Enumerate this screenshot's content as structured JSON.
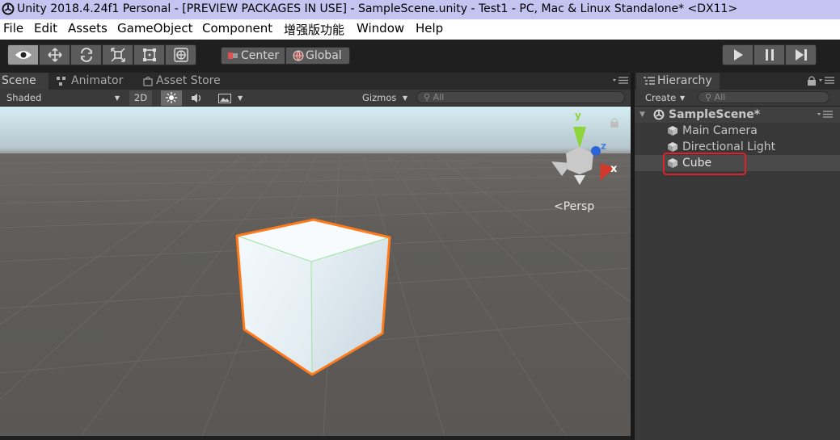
{
  "window": {
    "title": "Unity 2018.4.24f1 Personal - [PREVIEW PACKAGES IN USE] - SampleScene.unity - Test1 - PC, Mac & Linux Standalone* <DX11>"
  },
  "menu": [
    "File",
    "Edit",
    "Assets",
    "GameObject",
    "Component",
    "增强版功能",
    "Window",
    "Help"
  ],
  "toolbar": {
    "tools": [
      "view-tool-icon",
      "move-tool-icon",
      "rotate-tool-icon",
      "scale-tool-icon",
      "rect-tool-icon",
      "transform-tool-icon"
    ],
    "pivot_mode": "Center",
    "pivot_rotation": "Global",
    "play_controls": [
      "play-icon",
      "pause-icon",
      "step-icon"
    ]
  },
  "scene_panel": {
    "tabs": [
      "Scene",
      "Animator",
      "Asset Store"
    ],
    "draw_mode": "Shaded",
    "mode_2d": "2D",
    "gizmos": "Gizmos",
    "search_placeholder": "All",
    "gizmo_axes": {
      "y": "y",
      "z": "z",
      "x": "x"
    },
    "projection": "Persp"
  },
  "hierarchy": {
    "tab": "Hierarchy",
    "create": "Create",
    "search_placeholder": "All",
    "scene_name": "SampleScene*",
    "items": [
      {
        "label": "Main Camera",
        "selected": false
      },
      {
        "label": "Directional Light",
        "selected": false
      },
      {
        "label": "Cube",
        "selected": true,
        "highlighted": true
      }
    ]
  },
  "colors": {
    "selection_outline": "#ff7a1a",
    "highlight_box": "#e0202a",
    "title_bar": "#c4c4f0",
    "sky_top": "#d6ecf3",
    "ground": "#5f5c59"
  }
}
